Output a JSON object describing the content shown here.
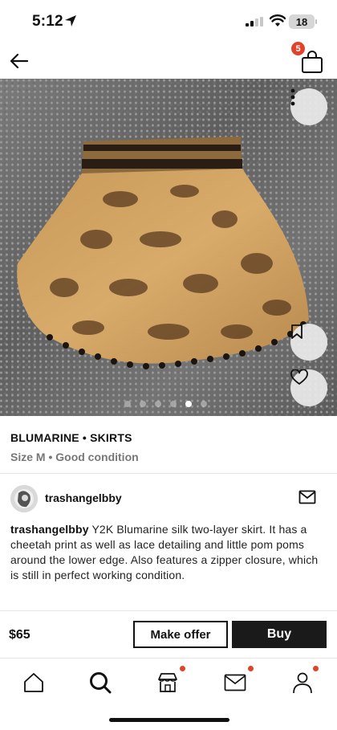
{
  "status_bar": {
    "time": "5:12",
    "battery": "18"
  },
  "nav": {
    "bag_count": "5"
  },
  "photo": {
    "image_count": 6,
    "active_index": 4
  },
  "item": {
    "title": "BLUMARINE • SKIRTS",
    "subtitle": "Size M • Good condition"
  },
  "seller": {
    "username": "trashangelbby"
  },
  "description": {
    "author": "trashangelbby",
    "text": "Y2K Blumarine silk two-layer skirt. It has a cheetah print as well as lace detailing and little pom poms around the lower edge. Also features a zipper closure, which is still in perfect working condition."
  },
  "purchase": {
    "price": "$65",
    "offer_label": "Make offer",
    "buy_label": "Buy"
  },
  "tab_bar": {
    "items": [
      {
        "icon": "home-icon",
        "badge": false
      },
      {
        "icon": "search-icon",
        "badge": false
      },
      {
        "icon": "shop-icon",
        "badge": true
      },
      {
        "icon": "mail-icon",
        "badge": true
      },
      {
        "icon": "profile-icon",
        "badge": true
      }
    ]
  },
  "colors": {
    "accent_badge": "#e0432a",
    "buy_bg": "#1a1a1a"
  }
}
